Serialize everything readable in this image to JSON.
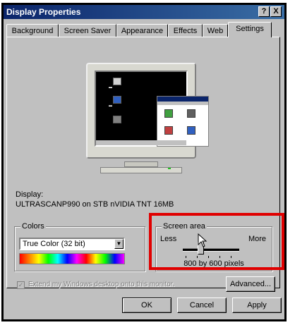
{
  "window": {
    "title": "Display Properties",
    "help_label": "?",
    "close_label": "X"
  },
  "tabs": [
    {
      "label": "Background"
    },
    {
      "label": "Screen Saver"
    },
    {
      "label": "Appearance"
    },
    {
      "label": "Effects"
    },
    {
      "label": "Web"
    },
    {
      "label": "Settings"
    }
  ],
  "active_tab": "Settings",
  "display": {
    "label": "Display:",
    "value": "ULTRASCANP990 on STB nVIDIA TNT 16MB"
  },
  "colors": {
    "group_label": "Colors",
    "selected": "True Color (32 bit)"
  },
  "screen_area": {
    "group_label": "Screen area",
    "less_label": "Less",
    "more_label": "More",
    "resolution_text": "800 by 600 pixels",
    "slider_position": 0.3
  },
  "extend_checkbox": {
    "label": "Extend my Windows desktop onto this monitor.",
    "checked": true,
    "enabled": false
  },
  "buttons": {
    "advanced": "Advanced...",
    "ok": "OK",
    "cancel": "Cancel",
    "apply": "Apply"
  },
  "colors_theme": {
    "highlight": "#e00000",
    "title_bar": "#0a246a"
  }
}
